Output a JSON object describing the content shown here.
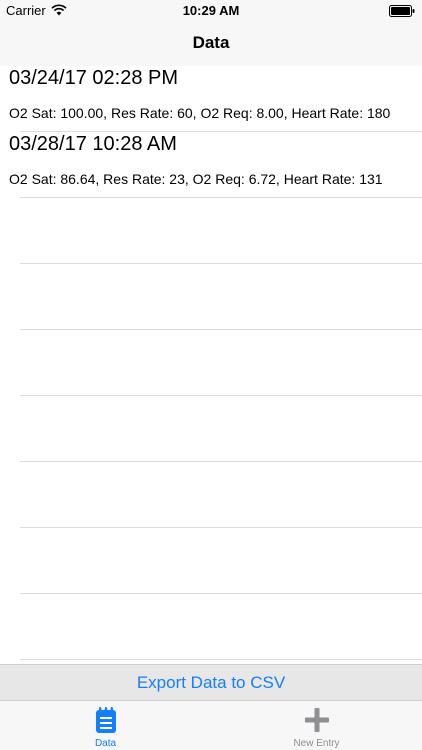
{
  "status_bar": {
    "carrier": "Carrier",
    "time": "10:29 AM",
    "icons": [
      "wifi-icon",
      "battery-icon"
    ]
  },
  "nav": {
    "title": "Data"
  },
  "entries": [
    {
      "title": "03/24/17 02:28 PM",
      "detail": "O2 Sat: 100.00, Res Rate: 60, O2 Req: 8.00, Heart Rate: 180"
    },
    {
      "title": "03/28/17 10:28 AM",
      "detail": "O2 Sat: 86.64, Res Rate: 23, O2 Req: 6.72, Heart Rate: 131"
    }
  ],
  "export": {
    "label": "Export Data to CSV"
  },
  "tabs": [
    {
      "label": "Data",
      "icon": "notepad-icon",
      "selected": true
    },
    {
      "label": "New Entry",
      "icon": "plus-icon",
      "selected": false
    }
  ],
  "colors": {
    "accent": "#147efb",
    "inactive": "#8e8e93",
    "bar_background": "#f7f7f7",
    "export_background": "#e7e7e7",
    "separator": "#dcdcdc"
  }
}
